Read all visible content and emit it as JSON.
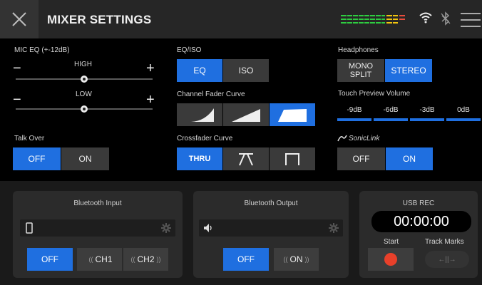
{
  "header": {
    "title": "MIXER SETTINGS",
    "meter_colors": [
      "#2ecc40",
      "#f1c40f",
      "#e74c3c"
    ]
  },
  "mic_eq": {
    "label": "MIC EQ (+-12dB)",
    "high_label": "HIGH",
    "low_label": "LOW",
    "minus": "−",
    "plus": "+",
    "high_value": 0,
    "low_value": 0
  },
  "eq_iso": {
    "label": "EQ/ISO",
    "options": [
      "EQ",
      "ISO"
    ],
    "selected": "EQ"
  },
  "headphones": {
    "label": "Headphones",
    "mono_split": "MONO\nSPLIT",
    "stereo": "STEREO",
    "selected": "STEREO"
  },
  "channel_fader_curve": {
    "label": "Channel Fader Curve",
    "selected_index": 2
  },
  "touch_preview": {
    "label": "Touch Preview Volume",
    "options": [
      "-9dB",
      "-6dB",
      "-3dB",
      "0dB"
    ]
  },
  "talk_over": {
    "label": "Talk Over",
    "off": "OFF",
    "on": "ON",
    "selected": "OFF"
  },
  "crossfader_curve": {
    "label": "Crossfader Curve",
    "thru": "THRU",
    "selected_index": 0
  },
  "soniclink": {
    "label": "SonicLink",
    "off": "OFF",
    "on": "ON",
    "selected": "ON"
  },
  "bluetooth_input": {
    "title": "Bluetooth Input",
    "off": "OFF",
    "ch1": "CH1",
    "ch2": "CH2",
    "selected": "OFF"
  },
  "bluetooth_output": {
    "title": "Bluetooth Output",
    "off": "OFF",
    "on": "ON",
    "selected": "OFF"
  },
  "usb_rec": {
    "title": "USB REC",
    "time": "00:00:00",
    "start": "Start",
    "track_marks": "Track Marks",
    "track_marks_glyph": "←||→"
  },
  "colors": {
    "accent": "#1f6fe0",
    "record": "#e8402a"
  },
  "icons": {
    "close": "close-icon",
    "wifi": "wifi-icon",
    "bluetooth": "bluetooth-icon",
    "menu": "menu-icon",
    "phone": "phone-icon",
    "speaker": "speaker-icon",
    "gear": "gear-icon",
    "record": "record-icon"
  }
}
